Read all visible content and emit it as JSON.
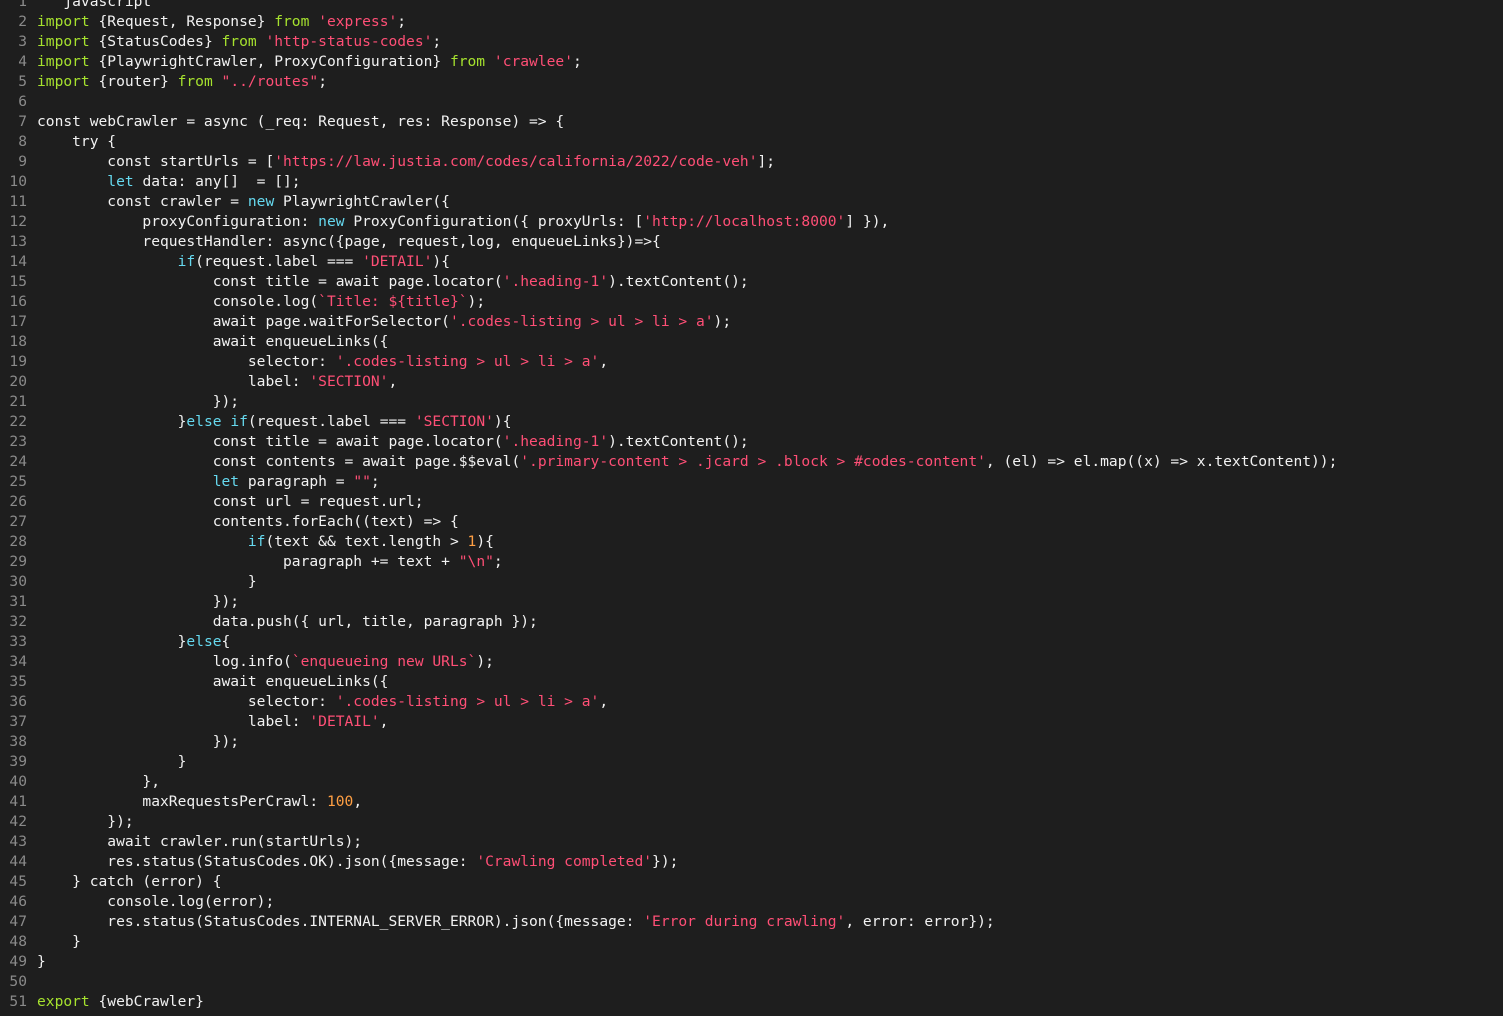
{
  "colors": {
    "background": "#1e1e1e",
    "text": "#f2f2f2",
    "line_number": "#8a8a8a",
    "keyword": "#66d9ef",
    "import_keyword": "#a6e22e",
    "string": "#ff4f76",
    "number": "#ff9f43"
  },
  "lines": [
    {
      "n": "1",
      "tokens": [
        [
          "t",
          "   javascript"
        ]
      ]
    },
    {
      "n": "2",
      "tokens": [
        [
          "kg",
          "import"
        ],
        [
          "t",
          " {Request, Response} "
        ],
        [
          "kg",
          "from"
        ],
        [
          "t",
          " "
        ],
        [
          "str",
          "'express'"
        ],
        [
          "t",
          ";"
        ]
      ]
    },
    {
      "n": "3",
      "tokens": [
        [
          "kg",
          "import"
        ],
        [
          "t",
          " {StatusCodes} "
        ],
        [
          "kg",
          "from"
        ],
        [
          "t",
          " "
        ],
        [
          "str",
          "'http-status-codes'"
        ],
        [
          "t",
          ";"
        ]
      ]
    },
    {
      "n": "4",
      "tokens": [
        [
          "kg",
          "import"
        ],
        [
          "t",
          " {PlaywrightCrawler, ProxyConfiguration} "
        ],
        [
          "kg",
          "from"
        ],
        [
          "t",
          " "
        ],
        [
          "str",
          "'crawlee'"
        ],
        [
          "t",
          ";"
        ]
      ]
    },
    {
      "n": "5",
      "tokens": [
        [
          "kg",
          "import"
        ],
        [
          "t",
          " {router} "
        ],
        [
          "kg",
          "from"
        ],
        [
          "t",
          " "
        ],
        [
          "str",
          "\"../routes\""
        ],
        [
          "t",
          ";"
        ]
      ]
    },
    {
      "n": "6",
      "tokens": [
        [
          "t",
          ""
        ]
      ]
    },
    {
      "n": "7",
      "tokens": [
        [
          "t",
          "const webCrawler = async (_req: Request, res: Response) => {"
        ]
      ]
    },
    {
      "n": "8",
      "tokens": [
        [
          "t",
          "    try {"
        ]
      ]
    },
    {
      "n": "9",
      "tokens": [
        [
          "t",
          "        const startUrls = ["
        ],
        [
          "str",
          "'https://law.justia.com/codes/california/2022/code-veh'"
        ],
        [
          "t",
          "];"
        ]
      ]
    },
    {
      "n": "10",
      "tokens": [
        [
          "t",
          "        "
        ],
        [
          "kw",
          "let"
        ],
        [
          "t",
          " data: any[]  = [];"
        ]
      ]
    },
    {
      "n": "11",
      "tokens": [
        [
          "t",
          "        const crawler = "
        ],
        [
          "kw",
          "new"
        ],
        [
          "t",
          " PlaywrightCrawler({"
        ]
      ]
    },
    {
      "n": "12",
      "tokens": [
        [
          "t",
          "            proxyConfiguration: "
        ],
        [
          "kw",
          "new"
        ],
        [
          "t",
          " ProxyConfiguration({ proxyUrls: ["
        ],
        [
          "str",
          "'http://localhost:8000'"
        ],
        [
          "t",
          "] }),"
        ]
      ]
    },
    {
      "n": "13",
      "tokens": [
        [
          "t",
          "            requestHandler: async({page, request,log, enqueueLinks})=>{"
        ]
      ]
    },
    {
      "n": "14",
      "tokens": [
        [
          "t",
          "                "
        ],
        [
          "kw",
          "if"
        ],
        [
          "t",
          "(request.label === "
        ],
        [
          "str",
          "'DETAIL'"
        ],
        [
          "t",
          "){"
        ]
      ]
    },
    {
      "n": "15",
      "tokens": [
        [
          "t",
          "                    const title = await page.locator("
        ],
        [
          "str",
          "'.heading-1'"
        ],
        [
          "t",
          ").textContent();"
        ]
      ]
    },
    {
      "n": "16",
      "tokens": [
        [
          "t",
          "                    console.log("
        ],
        [
          "str",
          "`Title: ${title}`"
        ],
        [
          "t",
          ");"
        ]
      ]
    },
    {
      "n": "17",
      "tokens": [
        [
          "t",
          "                    await page.waitForSelector("
        ],
        [
          "str",
          "'.codes-listing > ul > li > a'"
        ],
        [
          "t",
          ");"
        ]
      ]
    },
    {
      "n": "18",
      "tokens": [
        [
          "t",
          "                    await enqueueLinks({"
        ]
      ]
    },
    {
      "n": "19",
      "tokens": [
        [
          "t",
          "                        selector: "
        ],
        [
          "str",
          "'.codes-listing > ul > li > a'"
        ],
        [
          "t",
          ","
        ]
      ]
    },
    {
      "n": "20",
      "tokens": [
        [
          "t",
          "                        label: "
        ],
        [
          "str",
          "'SECTION'"
        ],
        [
          "t",
          ","
        ]
      ]
    },
    {
      "n": "21",
      "tokens": [
        [
          "t",
          "                    });"
        ]
      ]
    },
    {
      "n": "22",
      "tokens": [
        [
          "t",
          "                }"
        ],
        [
          "kw",
          "else"
        ],
        [
          "t",
          " "
        ],
        [
          "kw",
          "if"
        ],
        [
          "t",
          "(request.label === "
        ],
        [
          "str",
          "'SECTION'"
        ],
        [
          "t",
          "){"
        ]
      ]
    },
    {
      "n": "23",
      "tokens": [
        [
          "t",
          "                    const title = await page.locator("
        ],
        [
          "str",
          "'.heading-1'"
        ],
        [
          "t",
          ").textContent();"
        ]
      ]
    },
    {
      "n": "24",
      "tokens": [
        [
          "t",
          "                    const contents = await page.$$eval("
        ],
        [
          "str",
          "'.primary-content > .jcard > .block > #codes-content'"
        ],
        [
          "t",
          ", (el) => el.map((x) => x.textContent));"
        ]
      ]
    },
    {
      "n": "25",
      "tokens": [
        [
          "t",
          "                    "
        ],
        [
          "kw",
          "let"
        ],
        [
          "t",
          " paragraph = "
        ],
        [
          "str",
          "\"\""
        ],
        [
          "t",
          ";"
        ]
      ]
    },
    {
      "n": "26",
      "tokens": [
        [
          "t",
          "                    const url = request.url;"
        ]
      ]
    },
    {
      "n": "27",
      "tokens": [
        [
          "t",
          "                    contents.forEach((text) => {"
        ]
      ]
    },
    {
      "n": "28",
      "tokens": [
        [
          "t",
          "                        "
        ],
        [
          "kw",
          "if"
        ],
        [
          "t",
          "(text && text.length > "
        ],
        [
          "num",
          "1"
        ],
        [
          "t",
          "){"
        ]
      ]
    },
    {
      "n": "29",
      "tokens": [
        [
          "t",
          "                            paragraph += text + "
        ],
        [
          "str",
          "\"\\n\""
        ],
        [
          "t",
          ";"
        ]
      ]
    },
    {
      "n": "30",
      "tokens": [
        [
          "t",
          "                        }"
        ]
      ]
    },
    {
      "n": "31",
      "tokens": [
        [
          "t",
          "                    });"
        ]
      ]
    },
    {
      "n": "32",
      "tokens": [
        [
          "t",
          "                    data.push({ url, title, paragraph });"
        ]
      ]
    },
    {
      "n": "33",
      "tokens": [
        [
          "t",
          "                }"
        ],
        [
          "kw",
          "else"
        ],
        [
          "t",
          "{"
        ]
      ]
    },
    {
      "n": "34",
      "tokens": [
        [
          "t",
          "                    log.info("
        ],
        [
          "str",
          "`enqueueing new URLs`"
        ],
        [
          "t",
          ");"
        ]
      ]
    },
    {
      "n": "35",
      "tokens": [
        [
          "t",
          "                    await enqueueLinks({"
        ]
      ]
    },
    {
      "n": "36",
      "tokens": [
        [
          "t",
          "                        selector: "
        ],
        [
          "str",
          "'.codes-listing > ul > li > a'"
        ],
        [
          "t",
          ","
        ]
      ]
    },
    {
      "n": "37",
      "tokens": [
        [
          "t",
          "                        label: "
        ],
        [
          "str",
          "'DETAIL'"
        ],
        [
          "t",
          ","
        ]
      ]
    },
    {
      "n": "38",
      "tokens": [
        [
          "t",
          "                    });"
        ]
      ]
    },
    {
      "n": "39",
      "tokens": [
        [
          "t",
          "                }"
        ]
      ]
    },
    {
      "n": "40",
      "tokens": [
        [
          "t",
          "            },"
        ]
      ]
    },
    {
      "n": "41",
      "tokens": [
        [
          "t",
          "            maxRequestsPerCrawl: "
        ],
        [
          "num",
          "100"
        ],
        [
          "t",
          ","
        ]
      ]
    },
    {
      "n": "42",
      "tokens": [
        [
          "t",
          "        });"
        ]
      ]
    },
    {
      "n": "43",
      "tokens": [
        [
          "t",
          "        await crawler.run(startUrls);"
        ]
      ]
    },
    {
      "n": "44",
      "tokens": [
        [
          "t",
          "        res.status(StatusCodes.OK).json({message: "
        ],
        [
          "str",
          "'Crawling completed'"
        ],
        [
          "t",
          "});"
        ]
      ]
    },
    {
      "n": "45",
      "tokens": [
        [
          "t",
          "    } catch (error) {"
        ]
      ]
    },
    {
      "n": "46",
      "tokens": [
        [
          "t",
          "        console.log(error);"
        ]
      ]
    },
    {
      "n": "47",
      "tokens": [
        [
          "t",
          "        res.status(StatusCodes.INTERNAL_SERVER_ERROR).json({message: "
        ],
        [
          "str",
          "'Error during crawling'"
        ],
        [
          "t",
          ", error: error});"
        ]
      ]
    },
    {
      "n": "48",
      "tokens": [
        [
          "t",
          "    }"
        ]
      ]
    },
    {
      "n": "49",
      "tokens": [
        [
          "t",
          "}"
        ]
      ]
    },
    {
      "n": "50",
      "tokens": [
        [
          "t",
          ""
        ]
      ]
    },
    {
      "n": "51",
      "tokens": [
        [
          "kg",
          "export"
        ],
        [
          "t",
          " {webCrawler}"
        ]
      ]
    }
  ]
}
